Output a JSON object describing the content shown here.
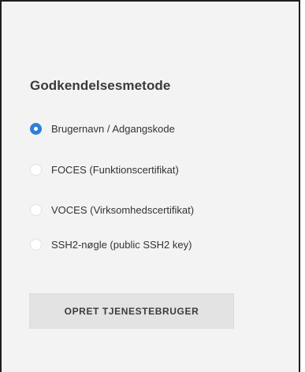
{
  "auth_method": {
    "title": "Godkendelsesmetode",
    "options": [
      {
        "label": "Brugernavn / Adgangskode",
        "selected": true
      },
      {
        "label": "FOCES (Funktionscertifikat)",
        "selected": false
      },
      {
        "label": "VOCES (Virksomhedscertifikat)",
        "selected": false
      },
      {
        "label": "SSH2-nøgle (public SSH2 key)",
        "selected": false
      }
    ]
  },
  "actions": {
    "create_button_label": "OPRET TJENESTEBRUGER"
  },
  "colors": {
    "accent": "#2d7fd8",
    "panel_background": "#f3f3f3",
    "button_background": "#e3e3e3"
  }
}
